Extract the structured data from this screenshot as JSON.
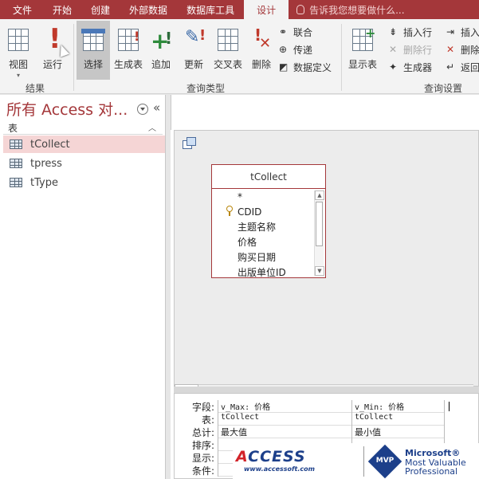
{
  "tabs": {
    "file": "文件",
    "home": "开始",
    "create": "创建",
    "external": "外部数据",
    "dbtools": "数据库工具",
    "design": "设计",
    "tell_me": "告诉我您想要做什么..."
  },
  "ribbon": {
    "results": {
      "group_label": "结果",
      "view": "视图",
      "run": "运行"
    },
    "query_type": {
      "group_label": "查询类型",
      "select": "选择",
      "make_table": "生成表",
      "append": "追加",
      "update": "更新",
      "crosstab": "交叉表",
      "delete": "删除",
      "union": "联合",
      "pass_through": "传递",
      "data_definition": "数据定义"
    },
    "query_setup": {
      "group_label": "查询设置",
      "show_table": "显示表",
      "insert_rows": "插入行",
      "delete_rows": "删除行",
      "builder": "生成器",
      "insert_cols": "插入",
      "delete_cols": "删除",
      "return": "返回"
    }
  },
  "nav": {
    "title": "所有 Access 对...",
    "category": "表",
    "items": [
      "tCollect",
      "tpress",
      "tType"
    ]
  },
  "fieldlist": {
    "title": "tCollect",
    "fields": [
      "*",
      "CDID",
      "主题名称",
      "价格",
      "购买日期",
      "出版单位ID"
    ]
  },
  "grid": {
    "row_labels": [
      "字段:",
      "表:",
      "总计:",
      "排序:",
      "显示:",
      "条件:"
    ],
    "columns": [
      {
        "field": "v_Max: 价格",
        "table": "tCollect",
        "total": "最大值"
      },
      {
        "field": "v_Min: 价格",
        "table": "tCollect",
        "total": "最小值"
      }
    ]
  },
  "watermark": {
    "logo_a": "A",
    "logo_rest": "CCESS",
    "url": "www.accessoft.com",
    "mvp": "MVP",
    "line1": "Microsoft®",
    "line2": "Most Valuable",
    "line3": "Professional"
  },
  "colors": {
    "accent": "#a4373a",
    "selected_nav": "#f5d5d5"
  }
}
